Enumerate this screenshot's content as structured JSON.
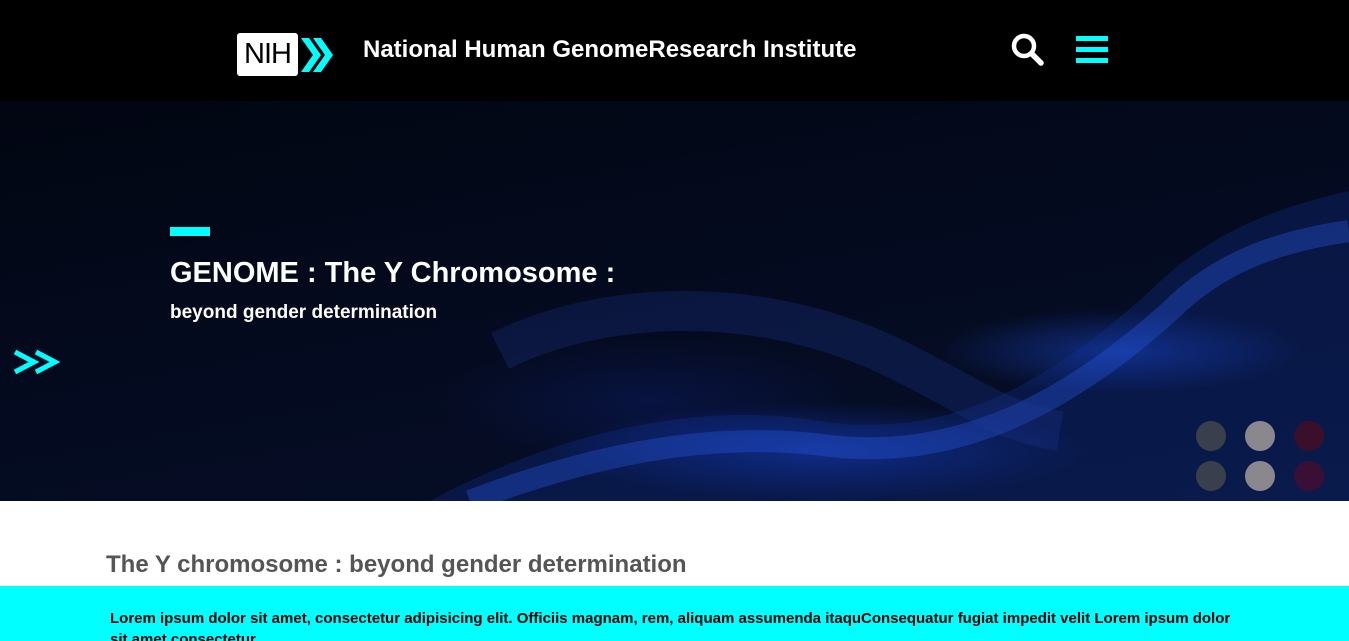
{
  "header": {
    "logo_text": "NIH",
    "site_title": "National Human GenomeResearch Institute",
    "icons": {
      "search": "search-icon",
      "menu": "hamburger-menu-icon"
    }
  },
  "hero": {
    "title": "GENOME : The Y Chromosome :",
    "subtitle": "beyond gender determination",
    "next_icon": "double-chevron-right-icon",
    "dots": [
      {
        "name": "carousel-dot-1",
        "color": "#3a3f4c"
      },
      {
        "name": "carousel-dot-2",
        "color": "#8b878f"
      },
      {
        "name": "carousel-dot-3",
        "color": "#3a0f2a"
      },
      {
        "name": "carousel-dot-4",
        "color": "#3a3f4c"
      },
      {
        "name": "carousel-dot-5",
        "color": "#8b878f"
      },
      {
        "name": "carousel-dot-6",
        "color": "#3a0f36"
      }
    ]
  },
  "content": {
    "heading": "The Y chromosome : beyond gender determination",
    "body": "Lorem ipsum dolor sit amet, consectetur adipisicing elit. Officiis magnam, rem, aliquam assumenda itaquConsequatur fugiat impedit velit Lorem ipsum dolor sit amet consectetur"
  },
  "colors": {
    "accent": "#00ffff",
    "header_bg": "#000000",
    "heading_text": "#555555"
  }
}
